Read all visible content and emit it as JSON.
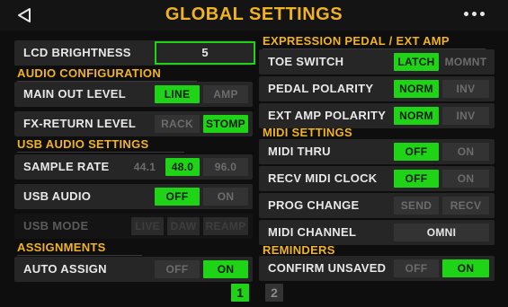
{
  "header": {
    "title": "GLOBAL SETTINGS",
    "back_icon": "back-arrow-icon",
    "more_icon": "more-dots-icon"
  },
  "left": {
    "lcd_brightness": {
      "label": "LCD BRIGHTNESS",
      "value": "5"
    },
    "audio_config": {
      "title": "AUDIO CONFIGURATION",
      "main_out": {
        "label": "MAIN OUT LEVEL",
        "options": [
          "LINE",
          "AMP"
        ],
        "selected": "LINE"
      },
      "fx_return": {
        "label": "FX-RETURN LEVEL",
        "options": [
          "RACK",
          "STOMP"
        ],
        "selected": "STOMP"
      }
    },
    "usb_audio": {
      "title": "USB AUDIO SETTINGS",
      "sample_rate": {
        "label": "SAMPLE RATE",
        "options": [
          "44.1",
          "48.0",
          "96.0"
        ],
        "selected": "48.0"
      },
      "usb_audio": {
        "label": "USB AUDIO",
        "options": [
          "OFF",
          "ON"
        ],
        "selected": "OFF"
      },
      "usb_mode": {
        "label": "USB MODE",
        "options": [
          "LIVE",
          "DAW",
          "REAMP"
        ]
      }
    },
    "assignments": {
      "title": "ASSIGNMENTS",
      "auto_assign": {
        "label": "AUTO ASSIGN",
        "options": [
          "OFF",
          "ON"
        ],
        "selected": "ON"
      }
    }
  },
  "right": {
    "expression": {
      "title": "EXPRESSION PEDAL / EXT AMP",
      "toe_switch": {
        "label": "TOE SWITCH",
        "options": [
          "LATCH",
          "MOMNT"
        ],
        "selected": "LATCH"
      },
      "pedal_polarity": {
        "label": "PEDAL POLARITY",
        "options": [
          "NORM",
          "INV"
        ],
        "selected": "NORM"
      },
      "ext_amp_polarity": {
        "label": "EXT AMP POLARITY",
        "options": [
          "NORM",
          "INV"
        ],
        "selected": "NORM"
      }
    },
    "midi": {
      "title": "MIDI SETTINGS",
      "midi_thru": {
        "label": "MIDI THRU",
        "options": [
          "OFF",
          "ON"
        ],
        "selected": "OFF"
      },
      "recv_midi_clock": {
        "label": "RECV MIDI CLOCK",
        "options": [
          "OFF",
          "ON"
        ],
        "selected": "OFF"
      },
      "prog_change": {
        "label": "PROG CHANGE",
        "options": [
          "SEND",
          "RECV"
        ]
      },
      "midi_channel": {
        "label": "MIDI CHANNEL",
        "value": "OMNI"
      }
    },
    "reminders": {
      "title": "REMINDERS",
      "confirm_unsaved": {
        "label": "CONFIRM UNSAVED",
        "options": [
          "OFF",
          "ON"
        ],
        "selected": "ON"
      }
    }
  },
  "pager": {
    "pages": [
      "1",
      "2"
    ],
    "current": "1"
  },
  "colors": {
    "accent": "#f1b323",
    "active": "#1fd317",
    "row_bg": "#262626",
    "background": "#0e0e0e"
  }
}
